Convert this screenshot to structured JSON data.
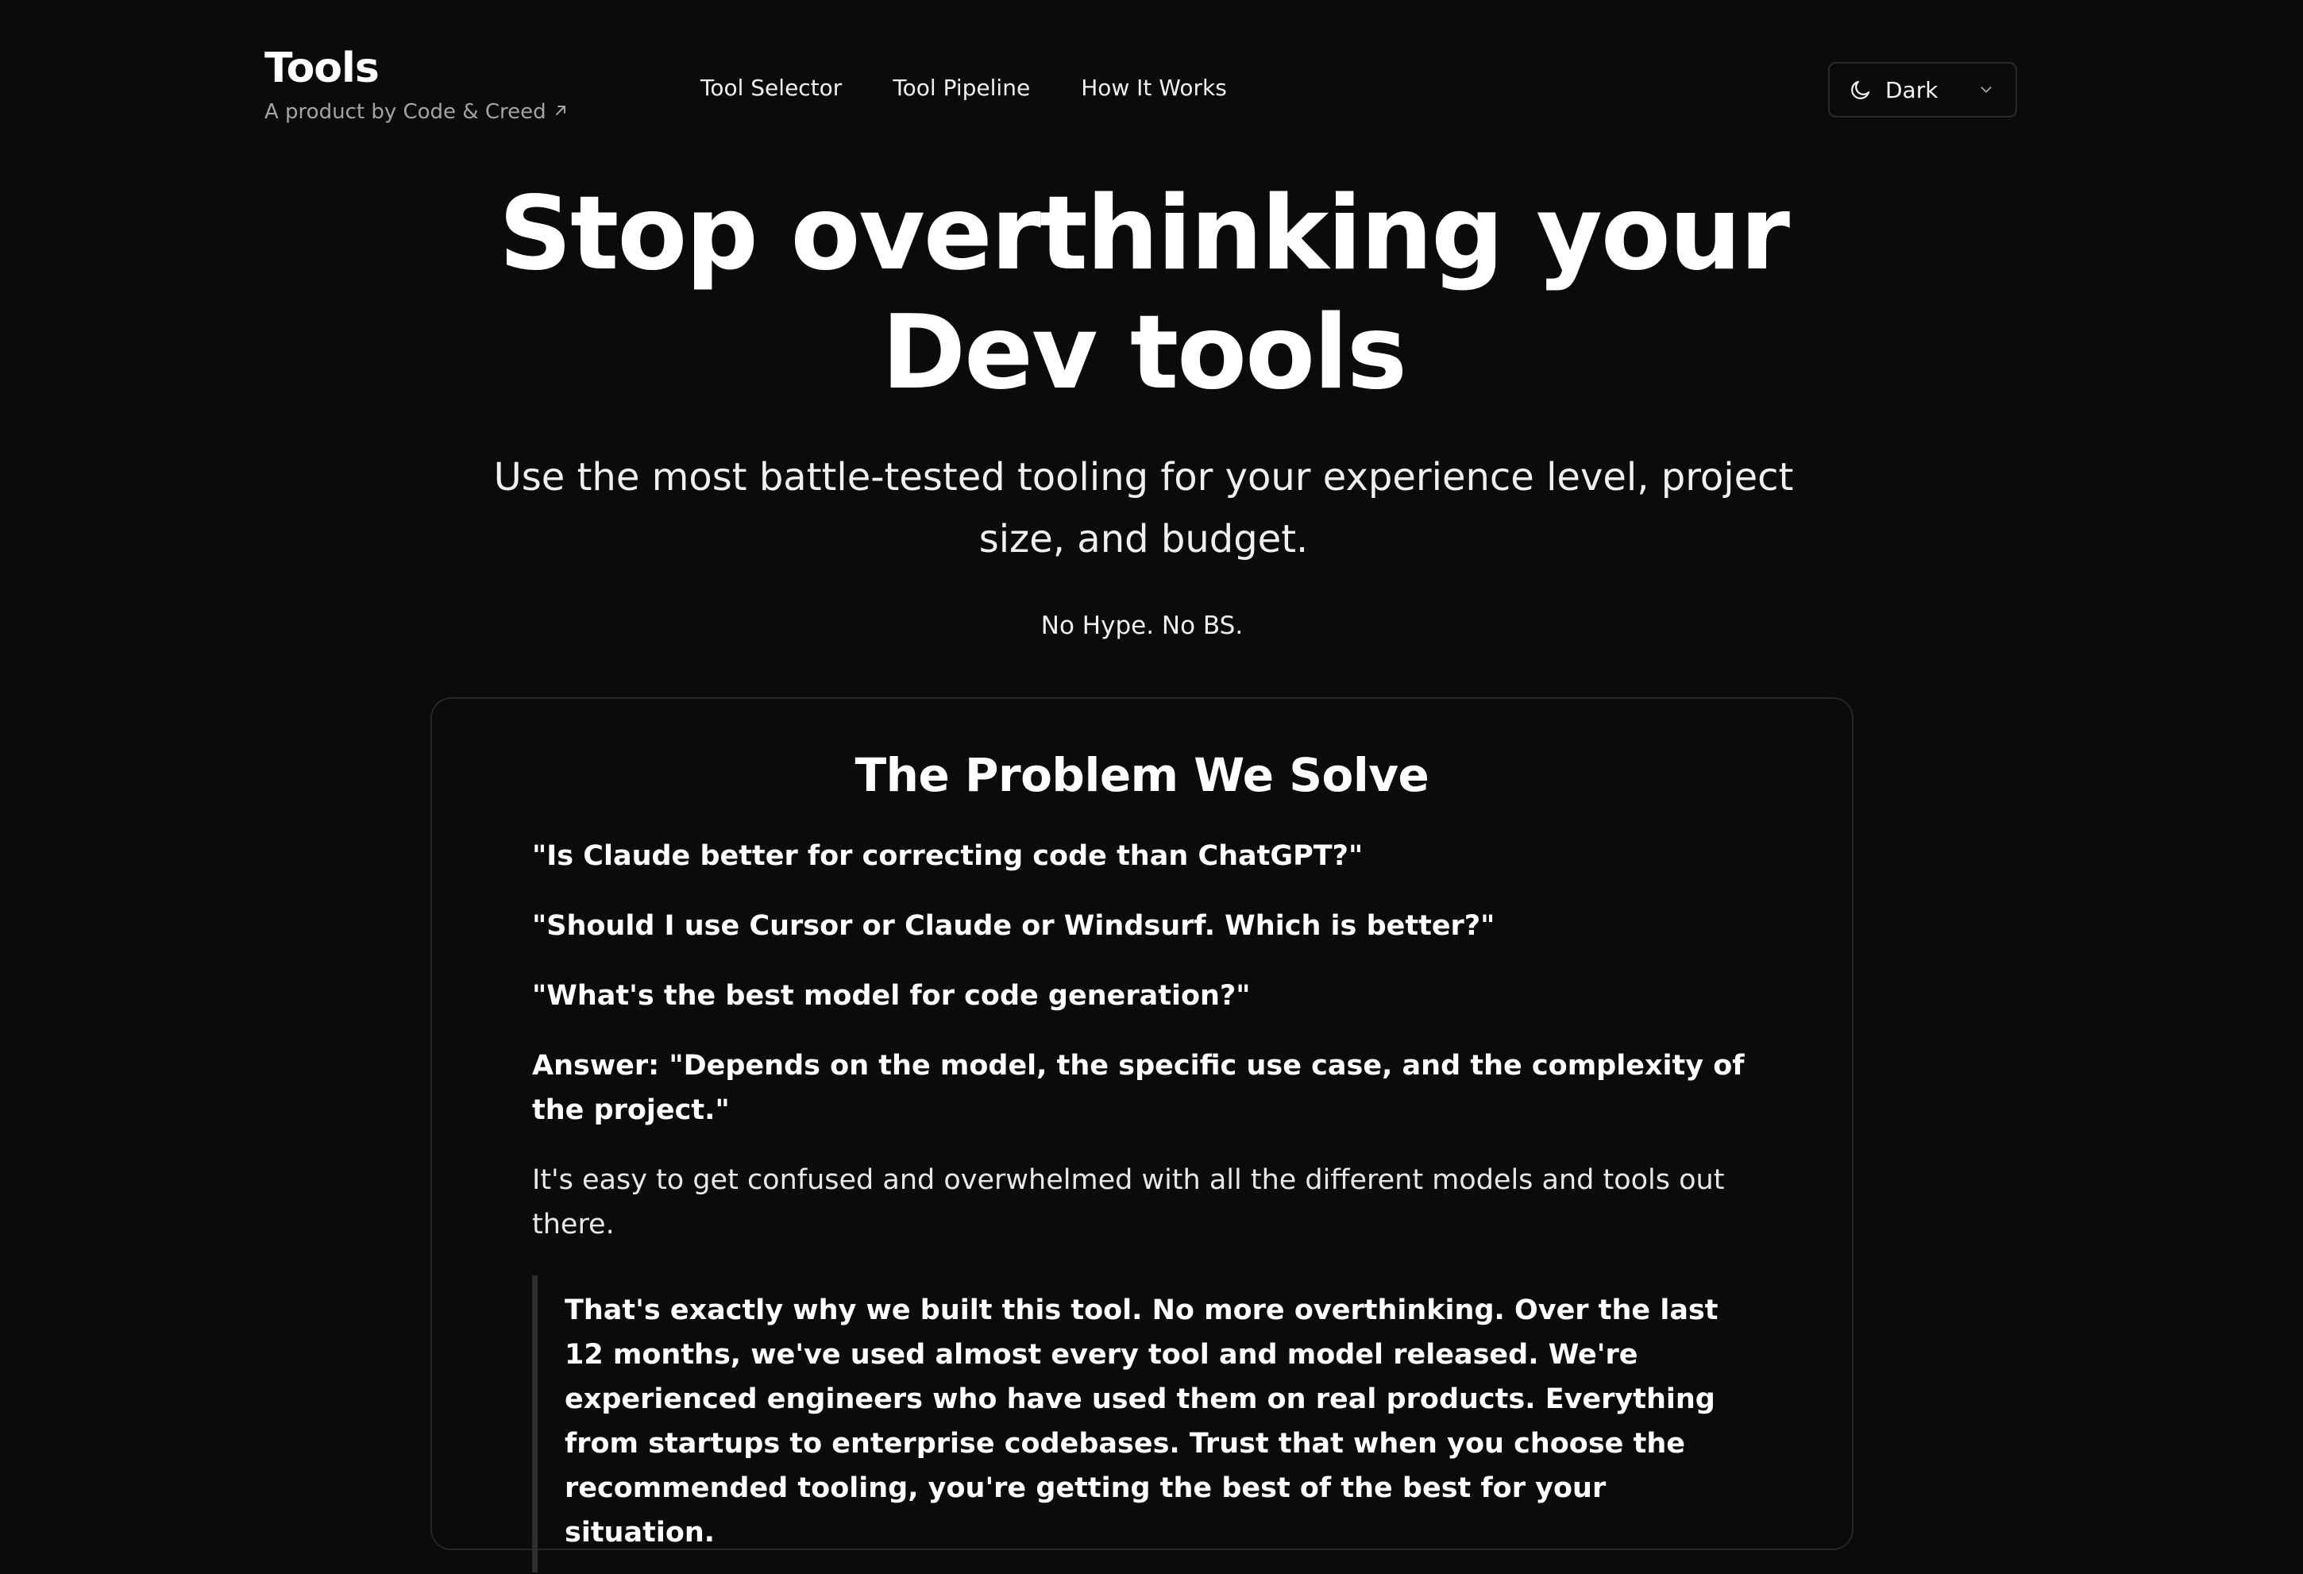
{
  "header": {
    "brand_title": "Tools",
    "brand_subtitle": "A product by Code & Creed",
    "brand_link_icon": "arrow-up-right-icon",
    "nav": [
      {
        "label": "Tool Selector"
      },
      {
        "label": "Tool Pipeline"
      },
      {
        "label": "How It Works"
      }
    ],
    "theme": {
      "label": "Dark",
      "icon": "moon-icon",
      "dropdown_icon": "chevron-down-icon"
    }
  },
  "hero": {
    "title_line1": "Stop overthinking your",
    "title_line2": "Dev tools",
    "subtitle": "Use the most battle-tested tooling for your experience level, project size, and budget.",
    "tagline": "No Hype. No BS."
  },
  "problem": {
    "title": "The Problem We Solve",
    "questions": [
      "\"Is Claude better for correcting code than ChatGPT?\"",
      "\"Should I use Cursor or Claude or Windsurf. Which is better?\"",
      "\"What's the best model for code generation?\""
    ],
    "answer": "Answer: \"Depends on the model, the specific use case, and the complexity of the project.\"",
    "confusion": "It's easy to get confused and overwhelmed with all the different models and tools out there.",
    "quote": "That's exactly why we built this tool. No more overthinking. Over the last 12 months, we've used almost every tool and model released. We're experienced engineers who have used them on real products. Everything from startups to enterprise codebases. Trust that when you choose the recommended tooling, you're getting the best of the best for your situation."
  },
  "colors": {
    "background": "#0b0b0b",
    "text": "#ffffff",
    "muted": "#a3a3a3",
    "border": "#262626"
  }
}
